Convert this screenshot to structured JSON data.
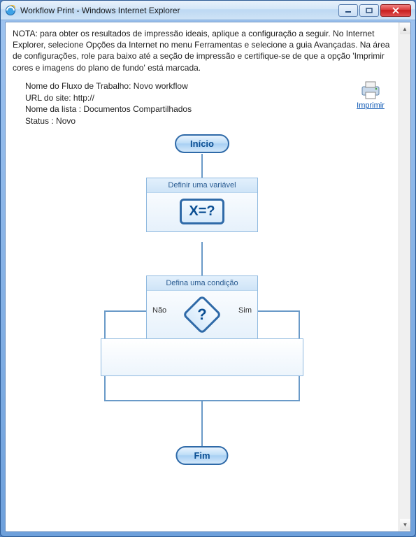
{
  "window": {
    "title": "Workflow Print - Windows Internet Explorer"
  },
  "note": "NOTA: para obter os resultados de impressão ideais, aplique a configuração a seguir. No Internet Explorer, selecione Opções da Internet no menu Ferramentas e selecione a guia Avançadas. Na área de configurações, role para baixo até a seção de impressão e certifique-se de que a opção 'Imprimir cores e imagens do plano de fundo' está marcada.",
  "meta": {
    "workflow_label": "Nome do Fluxo de Trabalho: Novo workflow",
    "site_label": "URL do site: http://",
    "list_label": "Nome da lista : Documentos Compartilhados",
    "status_label": "Status : Novo"
  },
  "print_link": "Imprimir",
  "diagram": {
    "start": "Início",
    "end": "Fim",
    "node1": {
      "title": "Definir uma variável",
      "symbol": "X=?"
    },
    "node2": {
      "title": "Defina uma condição",
      "no": "Não",
      "yes": "Sim"
    }
  }
}
